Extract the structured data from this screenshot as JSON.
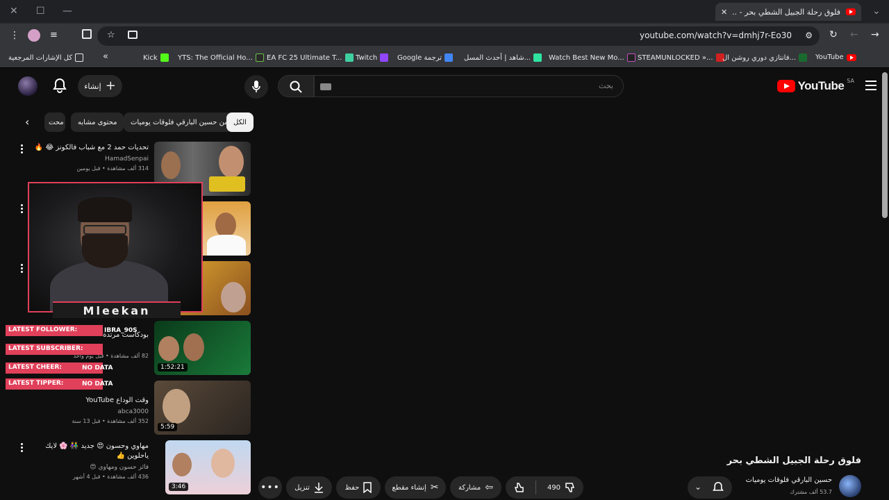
{
  "browser": {
    "tab_title": "فلوق رحلة الجبيل الشطي بحر - ...",
    "url": "youtube.com/watch?v=dmhj7r-Eo30",
    "bookmarks": [
      "YouTube",
      "فانتازي دوري روشن ال...",
      "STEAMUNLOCKED »...",
      "Watch Best New Mo...",
      "شاهد | أحدث المسل...",
      "Google ترجمة",
      "Twitch",
      "EA FC 25 Ultimate T...",
      "YTS: The Official Ho...",
      "Kick"
    ],
    "all_bookmarks": "كل الإشارات المرجعية"
  },
  "yt": {
    "logo_text": "YouTube",
    "country": "SA",
    "search_placeholder": "بحث",
    "create_label": "إنشاء"
  },
  "chips": [
    "الكل",
    "من حسين البارقي فلوقات يوميات",
    "محتوى مشابه",
    "محت"
  ],
  "videos": [
    {
      "title": "تحديات حمد 2 مع شباب فالكونز 😂 🔥",
      "channel": "HamadSenpai",
      "stats": "314 ألف مشاهدة • قبل يومين",
      "duration": ""
    },
    {
      "title": "",
      "channel": "",
      "stats": "",
      "duration": ""
    },
    {
      "title": "",
      "channel": "",
      "stats": "",
      "duration": ""
    },
    {
      "title": "بودكاست مرتدة",
      "channel": "",
      "stats": "82 ألف مشاهدة • قبل يوم واحد",
      "duration": "1:52:21"
    },
    {
      "title": "وقت الوداع YouTube",
      "channel": "abca3000",
      "stats": "352 ألف مشاهدة • قبل 13 سنة",
      "duration": "5:59"
    },
    {
      "title": "مهاوي وحسون 😍 جديد 👫 🌸 لايك ياحلوين 👍",
      "channel": "فائز حسون ومهاوي 😍",
      "stats": "436 ألف مشاهدة • قبل 4 أشهر",
      "duration": "3:46"
    }
  ],
  "stream": {
    "name": "Mleekan",
    "overlays": [
      {
        "label": "LATEST FOLLOWER:",
        "value": "IBRA_90S"
      },
      {
        "label": "LATEST SUBSCRIBER:",
        "value": ""
      },
      {
        "label": "LATEST CHEER:",
        "value": "NO DATA"
      },
      {
        "label": "LATEST TIPPER:",
        "value": "NO DATA"
      }
    ]
  },
  "player": {
    "title": "فلوق رحلة الجبيل الشطي بحر",
    "channel": "حسين البارقي فلوقات يوميات",
    "subs": "53.7 ألف مشترك",
    "likes": "490",
    "share": "مشاركة",
    "clip": "إنشاء مقطع",
    "save": "حفظ",
    "download": "تنزيل"
  },
  "colors": {
    "accent": "#ff0000",
    "overlay": "#e0405a",
    "bg": "#0f0f0f"
  }
}
